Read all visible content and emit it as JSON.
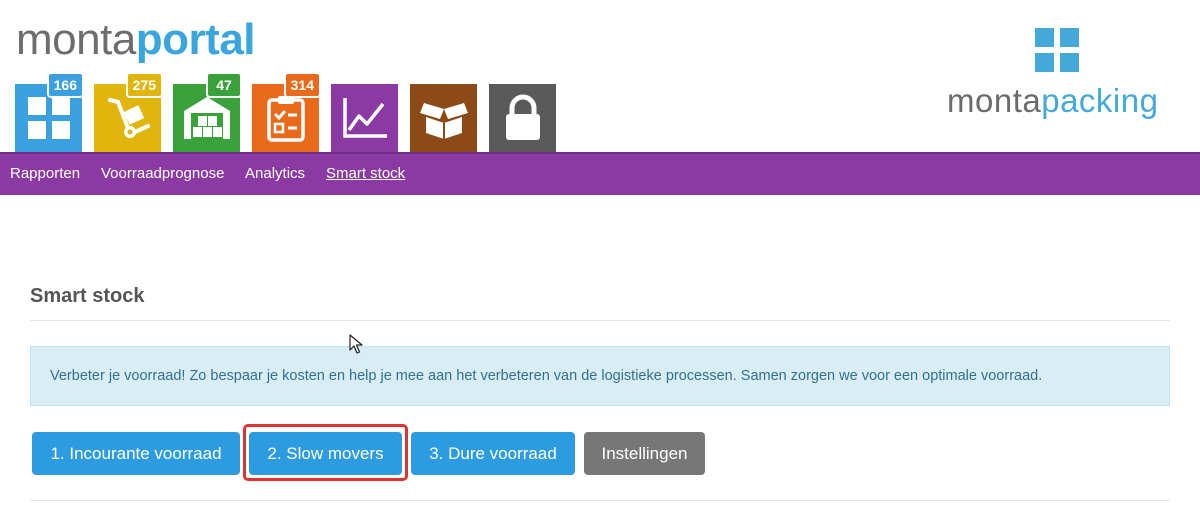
{
  "header": {
    "logo_part1": "monta",
    "logo_part2": "portal",
    "brand_part1": "monta",
    "brand_part2": "packing"
  },
  "tiles": [
    {
      "icon": "dashboard-grid-icon",
      "color": "#3aa0e0",
      "badge": "166",
      "badge_color": "#3aa0e0"
    },
    {
      "icon": "hand-truck-icon",
      "color": "#e0b50e",
      "badge": "275",
      "badge_color": "#e0b50e"
    },
    {
      "icon": "warehouse-icon",
      "color": "#3aa23a",
      "badge": "47",
      "badge_color": "#3aa23a"
    },
    {
      "icon": "clipboard-checklist-icon",
      "color": "#ea6a1c",
      "badge": "314",
      "badge_color": "#ea6a1c"
    },
    {
      "icon": "line-chart-icon",
      "color": "#8a3aa2",
      "badge": "",
      "badge_color": ""
    },
    {
      "icon": "open-box-icon",
      "color": "#8b4a16",
      "badge": "",
      "badge_color": ""
    },
    {
      "icon": "padlock-icon",
      "color": "#5a5a5a",
      "badge": "",
      "badge_color": ""
    }
  ],
  "nav": {
    "items": [
      {
        "label": "Rapporten"
      },
      {
        "label": "Voorraadprognose"
      },
      {
        "label": "Analytics"
      },
      {
        "label": "Smart stock",
        "active": true
      }
    ]
  },
  "main": {
    "title": "Smart stock",
    "info_text": "Verbeter je voorraad! Zo bespaar je kosten en help je mee aan het verbeteren van de logistieke processen. Samen zorgen we voor een optimale voorraad.",
    "buttons": [
      {
        "label": "1. Incourante voorraad",
        "style": "blue"
      },
      {
        "label": "2. Slow movers",
        "style": "blue",
        "highlighted": true
      },
      {
        "label": "3. Dure voorraad",
        "style": "blue"
      },
      {
        "label": "Instellingen",
        "style": "grey"
      }
    ]
  },
  "colors": {
    "nav_purple": "#8a3aa2",
    "button_blue": "#2d9be0",
    "button_grey": "#777777",
    "highlight_red": "#e0322f",
    "info_bg": "#d9edf7"
  }
}
